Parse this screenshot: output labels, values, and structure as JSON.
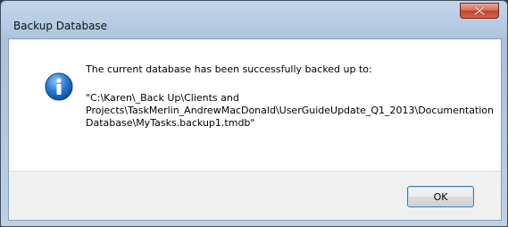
{
  "window": {
    "title": "Backup Database",
    "close_icon": "close-icon"
  },
  "dialog": {
    "icon": "info-icon",
    "message": "The current database has been successfully backed up to:",
    "path": "\"C:\\Karen\\_Back Up\\Clients and Projects\\TaskMerlin_AndrewMacDonald\\UserGuideUpdate_Q1_2013\\Documentation Database\\MyTasks.backup1.tmdb\"",
    "ok_label": "OK"
  },
  "colors": {
    "info_blue": "#1b6cc6",
    "close_red": "#c2442c",
    "button_focus": "#3c7fb1"
  }
}
